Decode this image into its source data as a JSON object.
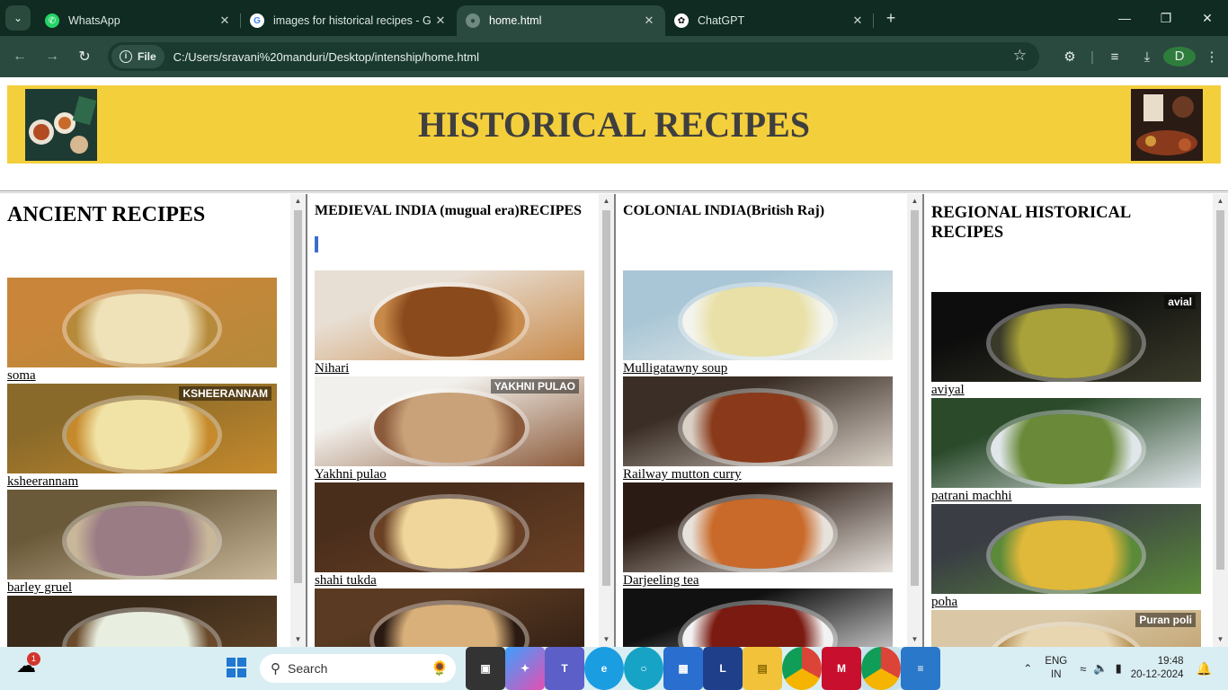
{
  "browser": {
    "tabs": [
      {
        "title": "WhatsApp",
        "favicon": "whatsapp-icon",
        "active": false
      },
      {
        "title": "images for historical recipes - G",
        "favicon": "google-icon",
        "active": false
      },
      {
        "title": "home.html",
        "favicon": "globe-icon",
        "active": true
      },
      {
        "title": "ChatGPT",
        "favicon": "chatgpt-icon",
        "active": false
      }
    ],
    "address": {
      "chip_label": "File",
      "url": "C:/Users/sravani%20manduri/Desktop/intenship/home.html"
    },
    "profile_initial": "D"
  },
  "page": {
    "banner_title": "HISTORICAL RECIPES",
    "columns": [
      {
        "heading": "ANCIENT RECIPES",
        "items": [
          {
            "label": "soma",
            "palette": [
              "#c9863a",
              "#efe2b8",
              "#b58a3a"
            ]
          },
          {
            "label": "ksheerannam",
            "palette": [
              "#8a6a2a",
              "#f1e3a6",
              "#c68a2c"
            ],
            "overlay_text": "KSHEERANNAM"
          },
          {
            "label": "barley gruel",
            "palette": [
              "#6a5a3a",
              "#9a7c84",
              "#c9b79a"
            ]
          },
          {
            "label": "",
            "palette": [
              "#3a2a1a",
              "#e9efe0",
              "#6a4a2a"
            ]
          }
        ]
      },
      {
        "heading": "MEDIEVAL INDIA (mugual era)RECIPES",
        "items": [
          {
            "label": "Nihari",
            "palette": [
              "#e8dfd4",
              "#8a4a1c",
              "#c88a4a"
            ]
          },
          {
            "label": "Yakhni pulao",
            "palette": [
              "#f2f0ec",
              "#c9a27a",
              "#8b5a3a"
            ],
            "overlay_text": "YAKHNI PULAO"
          },
          {
            "label": "shahi tukda",
            "palette": [
              "#4a2e1c",
              "#f0d69a",
              "#6a4024"
            ]
          },
          {
            "label": "",
            "palette": [
              "#5a3a22",
              "#d9b07a",
              "#2a1a12"
            ]
          }
        ]
      },
      {
        "heading": "COLONIAL INDIA(British Raj)",
        "items": [
          {
            "label": "Mulligatawny soup",
            "palette": [
              "#a9c6d6",
              "#e8e0a6",
              "#f4f4ee"
            ]
          },
          {
            "label": "Railway mutton curry",
            "palette": [
              "#3a2e26",
              "#8a3a1a",
              "#d9d0c6"
            ]
          },
          {
            "label": "Darjeeling tea",
            "palette": [
              "#2a1c14",
              "#c96a2a",
              "#e8e2dc"
            ]
          },
          {
            "label": "",
            "palette": [
              "#111111",
              "#7a1a10",
              "#f2f2f2"
            ]
          }
        ]
      },
      {
        "heading": "REGIONAL HISTORICAL RECIPES",
        "items": [
          {
            "label": "aviyal",
            "palette": [
              "#0d0d0d",
              "#a9a23a",
              "#3a3a2a"
            ],
            "overlay_text": "avial"
          },
          {
            "label": "patrani machhi",
            "palette": [
              "#2a4a2a",
              "#6a8a3a",
              "#e0e6ea"
            ]
          },
          {
            "label": "poha",
            "palette": [
              "#3a3e44",
              "#e0b83a",
              "#5a8a3a"
            ]
          },
          {
            "label": "",
            "palette": [
              "#d9c7a6",
              "#e8d6b0",
              "#b8945a"
            ],
            "overlay_text": "Puran poli"
          }
        ]
      }
    ]
  },
  "taskbar": {
    "weather_badge": "1",
    "search_placeholder": "Search",
    "lang_line1": "ENG",
    "lang_line2": "IN",
    "time": "19:48",
    "date": "20-12-2024"
  },
  "colors": {
    "banner": "#f4cf3c",
    "title": "#3f3f3f",
    "chrome_dark": "#0f2b22",
    "chrome_toolbar": "#2b4a3f",
    "taskbar": "#d9eef3"
  }
}
